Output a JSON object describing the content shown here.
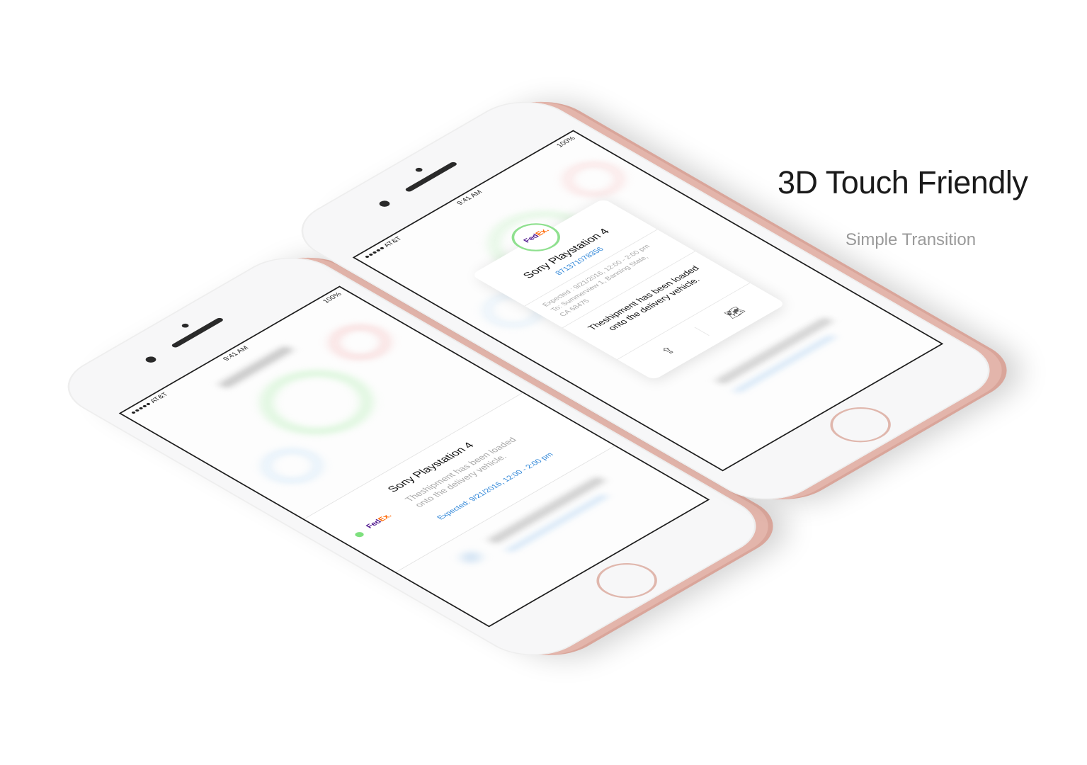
{
  "headline": "3D Touch Friendly",
  "subline": "Simple Transition",
  "colors": {
    "fedex_purple": "#4d148c",
    "fedex_orange": "#ff6600",
    "link_blue": "#2f86d8",
    "status_green": "#7ee07e",
    "rose_gold": "#e3b5ab"
  },
  "phone_left": {
    "status": {
      "carrier": "●●●●● AT&T",
      "time": "9:41 AM",
      "battery": "100%"
    },
    "row": {
      "carrier_logo_fed": "Fed",
      "carrier_logo_ex": "Ex.",
      "title": "Sony Playstation 4",
      "message": "Theshipment has been loaded onto the delivery vehicle.",
      "expected": "Expected: 9/21/2016, 12:00 - 2:00 pm"
    }
  },
  "phone_right": {
    "status": {
      "carrier": "●●●●● AT&T",
      "time": "9:41 AM",
      "battery": "100%"
    },
    "popup": {
      "carrier_logo_fed": "Fed",
      "carrier_logo_ex": "Ex.",
      "title": "Sony Playstation 4",
      "tracking": "871371078356",
      "expected": "Expected : 9/21/2016, 12:00 - 2:00 pm",
      "address_line1": "To: Summerview 1, Banning State,",
      "address_line2": "CA 68475",
      "message": "Theshipment has been loaded onto the delivery vehicle.",
      "share_icon": "share-icon",
      "map_icon": "map-icon"
    }
  }
}
